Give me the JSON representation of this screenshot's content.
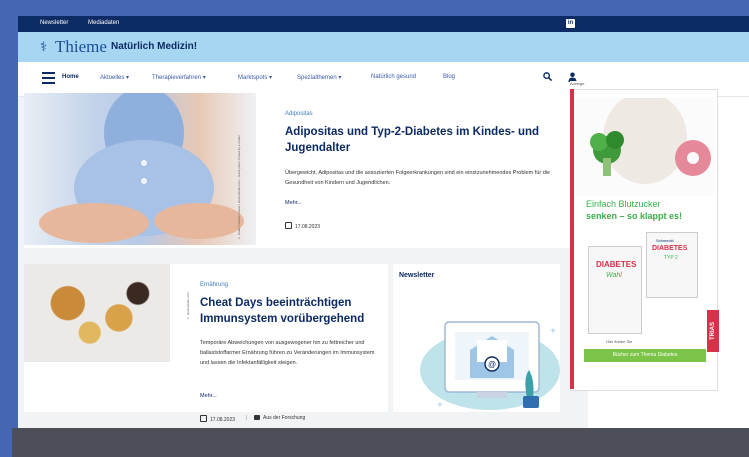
{
  "topbar": {
    "links": [
      "Newsletter",
      "Mediadaten"
    ]
  },
  "brand": {
    "logo": "Thieme",
    "tagline": "Natürlich Medizin!"
  },
  "nav": {
    "items": [
      "Home",
      "Aktuelles ▾",
      "Therapieverfahren ▾",
      "Marktspots ▾",
      "Spezialthemen ▾",
      "Natürlich gesund",
      "Blog"
    ]
  },
  "articles": [
    {
      "category": "Adipositas",
      "title": "Adipositas und Typ-2-Diabetes im Kindes- und Jugendalter",
      "teaser": "Übergewicht, Adipositas und die assoziierten Folgeerkrankungen sind ein einstzunehmendes Problem für die Gesundheit von Kindern und Jugendlichen.",
      "more": "Mehr...",
      "date": "17.08.2023",
      "credit": "© Inside Creative House / stock.adobe.com – Stock photo. Posed by a model"
    },
    {
      "category": "Ernährung",
      "title": "Cheat Days beeinträchtigen Immunsystem vorübergehend",
      "teaser": "Temporäre Abweichungen von ausgewogener hin zu fettreicher und ballaststoffarmer Ernährung führen zu Veränderungen im Immunsystem und lassen die Infektanfälligkeit steigen.",
      "more": "Mehr...",
      "date": "17.08.2023",
      "source": "Aus der Forschung",
      "credit": "© stock.adobe.com"
    }
  ],
  "newsletter": {
    "title": "Newsletter"
  },
  "ad": {
    "label": "Anzeige",
    "headline_1": "Einfach Blutzucker",
    "headline_2": "senken – so klappt es!",
    "book1_title": "DIABETES",
    "book1_sub": "Wahl",
    "book2_top": "Schmeckt",
    "book2_title": "DIABETES",
    "book2_sub": "TYP 2",
    "small": "Hier finden Sie",
    "button": "Bücher zum Thema Diabetes",
    "brand": "TRIAS"
  },
  "colors": {
    "navy": "#0c2a63",
    "sky": "#a6d6f2",
    "green": "#7cc447",
    "red": "#d8314a"
  }
}
